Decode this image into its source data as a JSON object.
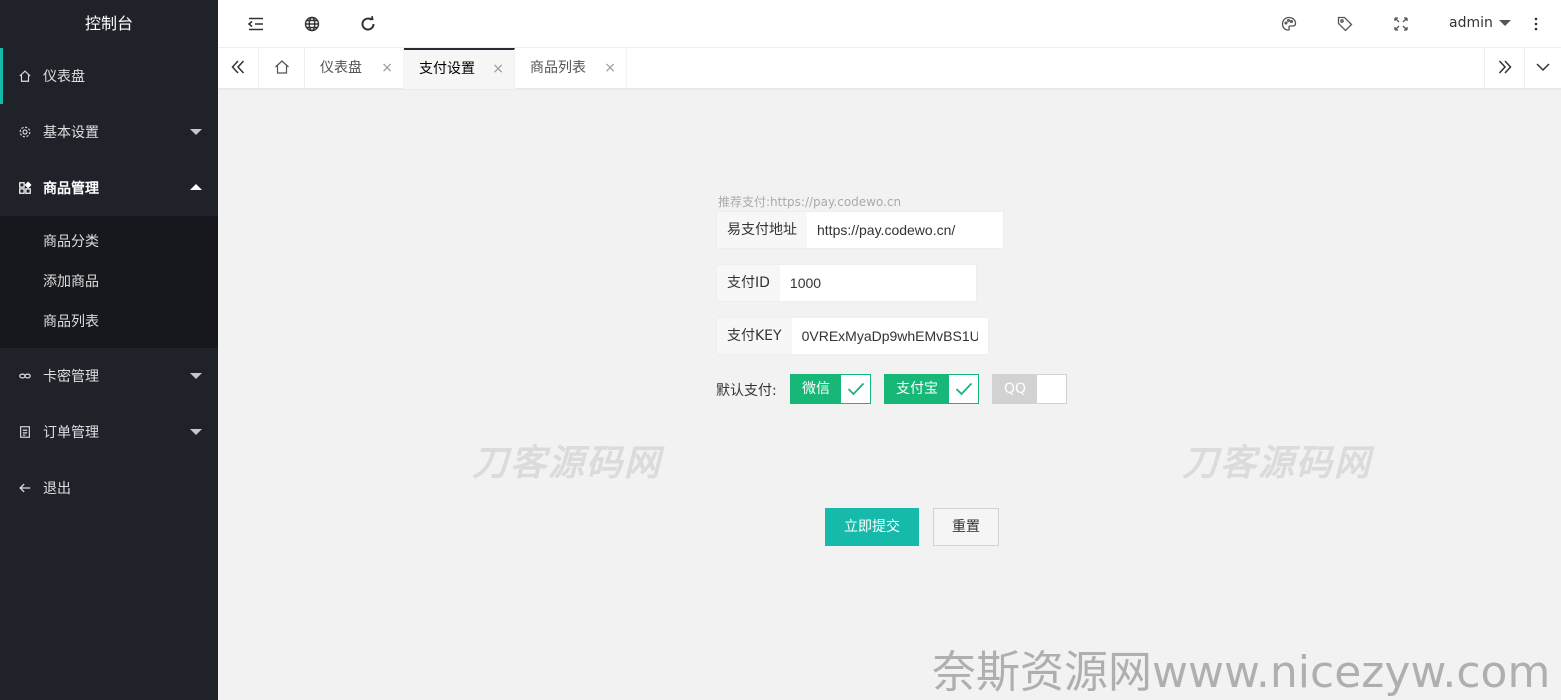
{
  "sidebar": {
    "title": "控制台",
    "items": [
      {
        "label": "仪表盘",
        "icon": "home-icon"
      },
      {
        "label": "基本设置",
        "icon": "gear-icon"
      },
      {
        "label": "商品管理",
        "icon": "app-grid-icon"
      },
      {
        "label": "卡密管理",
        "icon": "link-icon"
      },
      {
        "label": "订单管理",
        "icon": "list-icon"
      },
      {
        "label": "退出",
        "icon": "arrow-left-icon"
      }
    ],
    "sub_items": [
      "商品分类",
      "添加商品",
      "商品列表"
    ]
  },
  "header": {
    "user": "admin",
    "icons": [
      "menu-fold-icon",
      "globe-icon",
      "refresh-icon",
      "palette-icon",
      "tag-icon",
      "fullscreen-icon",
      "more-vertical-icon"
    ]
  },
  "tabs": [
    {
      "label": "仪表盘",
      "close": "×"
    },
    {
      "label": "支付设置",
      "close": "×"
    },
    {
      "label": "商品列表",
      "close": "×"
    }
  ],
  "form": {
    "hint": "推荐支付:https://pay.codewo.cn",
    "url_label": "易支付地址",
    "url_value": "https://pay.codewo.cn/",
    "id_label": "支付ID",
    "id_value": "1000",
    "key_label": "支付KEY",
    "key_value": "0VRExMyaDp9whEMvBS1U",
    "pay_label": "默认支付:",
    "switches": [
      {
        "label": "微信",
        "checked": true
      },
      {
        "label": "支付宝",
        "checked": true
      },
      {
        "label": "QQ",
        "checked": false
      }
    ],
    "submit_label": "立即提交",
    "reset_label": "重置"
  },
  "watermarks": {
    "center": "刀客源码网",
    "bottom": "奈斯资源网www.nicezyw.com"
  },
  "colors": {
    "sidebar_bg": "#20222a",
    "accent": "#16baaa",
    "switch_on": "#16b777"
  }
}
